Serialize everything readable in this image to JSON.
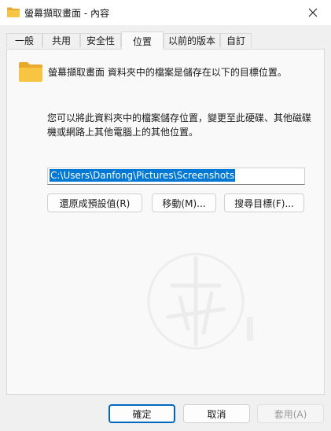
{
  "window": {
    "title": "螢幕擷取畫面 - 內容",
    "close_icon": "close-icon",
    "folder_icon": "folder-icon"
  },
  "tabs": [
    {
      "label": "一般"
    },
    {
      "label": "共用"
    },
    {
      "label": "安全性"
    },
    {
      "label": "位置",
      "active": true
    },
    {
      "label": "以前的版本"
    },
    {
      "label": "自訂"
    }
  ],
  "location": {
    "folder_description": "螢幕擷取畫面 資料夾中的檔案是儲存在以下的目標位置。",
    "help_text": "您可以將此資料夾中的檔案儲存位置，變更至此硬碟、其他磁碟機或網路上其他電腦上的其他位置。",
    "path_value": "C:\\Users\\Danfong\\Pictures\\Screenshots",
    "restore_default_label": "還原成預設值(R)",
    "move_label": "移動(M)...",
    "find_target_label": "搜尋目標(F)..."
  },
  "footer": {
    "ok_label": "確定",
    "cancel_label": "取消",
    "apply_label": "套用(A)"
  },
  "colors": {
    "selection": "#0078d4",
    "ok_border": "#0067c0",
    "folder_yellow": "#f8c543"
  }
}
